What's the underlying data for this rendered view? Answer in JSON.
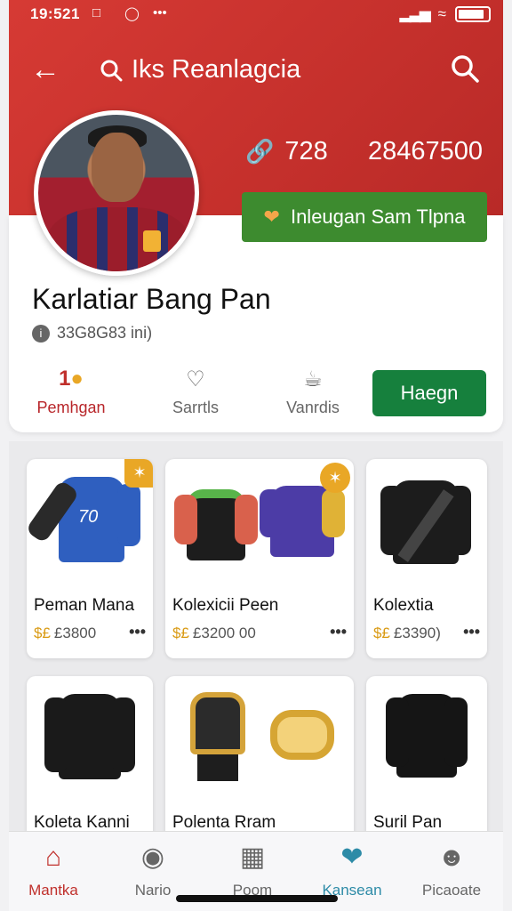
{
  "status_bar": {
    "time": "19:521",
    "icons": [
      "notification-icon",
      "whatsapp-icon",
      "more-icon"
    ],
    "right_icons": [
      "signal-icon",
      "wifi-icon",
      "battery-icon"
    ]
  },
  "topbar": {
    "title": "Iks Reanlagcia"
  },
  "profile": {
    "stat_a": "728",
    "stat_b": "28467500",
    "follow_label": "Inleugan Sam Tlpna",
    "name": "Karlatiar Bang Pan",
    "meta": "33G8G83 ini)"
  },
  "tabs": [
    {
      "label": "Pemhgan",
      "icon": "12"
    },
    {
      "label": "Sarrtls",
      "icon": "heart-check"
    },
    {
      "label": "Vanrdis",
      "icon": "cup"
    }
  ],
  "tab_cta": "Haegn",
  "products": [
    {
      "title": "Peman Mana",
      "currency": "$£",
      "price": "£3800",
      "badge": "✶"
    },
    {
      "title": "Kolexicii Peen",
      "currency": "$£",
      "price": "£3200 00",
      "badge": "✶"
    },
    {
      "title": "Kolextia",
      "currency": "$£",
      "price": "£3390)",
      "badge": ""
    },
    {
      "title": "Koleta Kanni",
      "currency": "",
      "price": "",
      "badge": ""
    },
    {
      "title": "Polenta Rram",
      "currency": "",
      "price": "",
      "badge": ""
    },
    {
      "title": "Suril Pan",
      "currency": "",
      "price": "",
      "badge": ""
    }
  ],
  "bottom_nav": [
    {
      "label": "Mantka",
      "icon": "home-icon"
    },
    {
      "label": "Nario",
      "icon": "headphones-icon"
    },
    {
      "label": "Poom",
      "icon": "image-icon"
    },
    {
      "label": "Kansean",
      "icon": "heart-icon"
    },
    {
      "label": "Picaoate",
      "icon": "profile-icon"
    }
  ],
  "colors": {
    "header_red": "#d63a34",
    "follow_green": "#3d8b2f",
    "cta_green": "#16803d",
    "accent_gold": "#e9a726"
  }
}
